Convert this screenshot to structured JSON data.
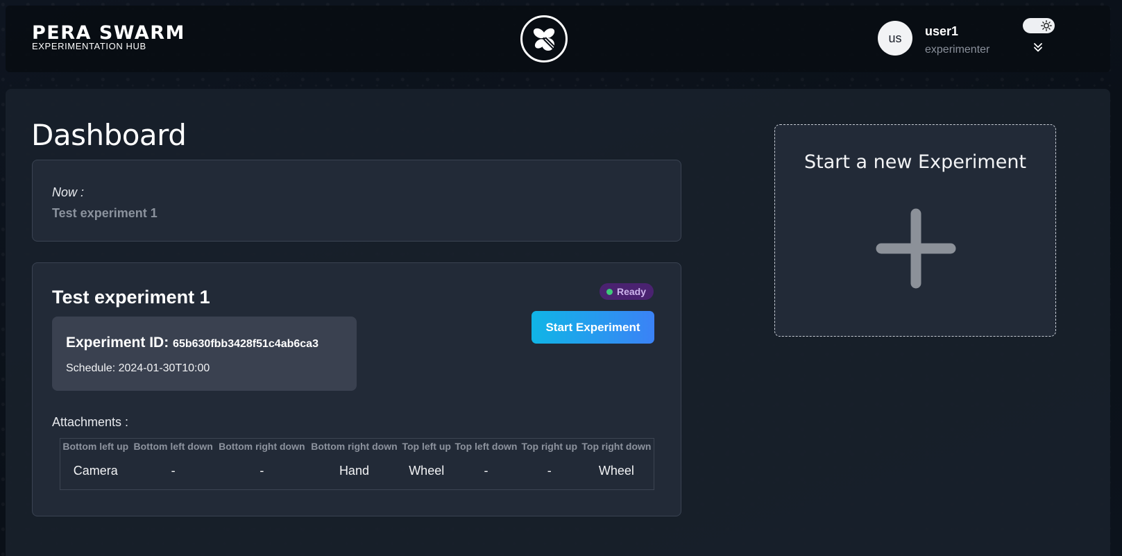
{
  "header": {
    "brand_title": "PERA SWARM",
    "brand_subtitle": "EXPERIMENTATION HUB",
    "center_logo_icon": "swarm-bee-logo",
    "user": {
      "avatar_initials": "us",
      "name": "user1",
      "role": "experimenter"
    },
    "theme_toggle_icon": "sun-icon",
    "menu_icon": "chevron-double-down-icon"
  },
  "page": {
    "title": "Dashboard"
  },
  "now_card": {
    "label": "Now :",
    "value": "Test experiment 1"
  },
  "experiment": {
    "title": "Test experiment 1",
    "status": "Ready",
    "status_color": "#3ec97a",
    "start_button": "Start Experiment",
    "id_label": "Experiment ID:",
    "id_value": "65b630fbb3428f51c4ab6ca3",
    "schedule": "Schedule: 2024-01-30T10:00",
    "attachments_label": "Attachments :",
    "attachments": {
      "headers": [
        "Bottom left up",
        "Bottom left down",
        "Bottom right down",
        "Bottom right down",
        "Top left up",
        "Top left down",
        "Top right up",
        "Top right down"
      ],
      "values": [
        "Camera",
        "-",
        "-",
        "Hand",
        "Wheel",
        "-",
        "-",
        "Wheel"
      ]
    }
  },
  "new_experiment": {
    "title": "Start a new Experiment",
    "icon": "plus-icon"
  },
  "colors": {
    "accent_gradient_start": "#10b5e6",
    "accent_gradient_end": "#3b82f6",
    "badge_bg": "#4a2270"
  }
}
